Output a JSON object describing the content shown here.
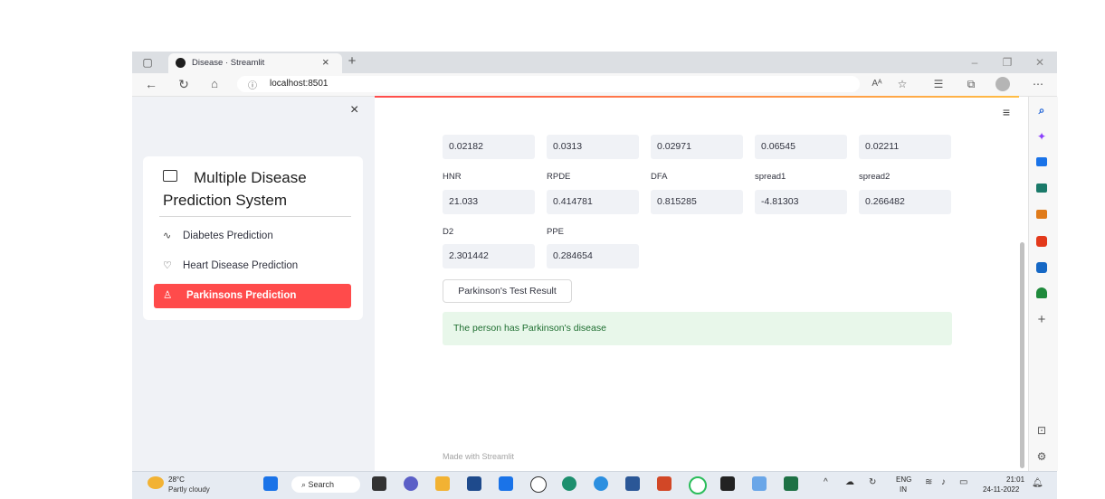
{
  "browser": {
    "tab_title": "Disease · Streamlit",
    "url": "localhost:8501",
    "reader_icon": "Aᴬ"
  },
  "sidebar": {
    "close_label": "×",
    "title": "Multiple Disease Prediction System",
    "items": [
      {
        "label": "Diabetes Prediction",
        "icon": "activity-icon"
      },
      {
        "label": "Heart Disease Prediction",
        "icon": "heart-icon"
      },
      {
        "label": "Parkinsons Prediction",
        "icon": "person-icon",
        "active": true
      }
    ],
    "accent": "#ff4b4b"
  },
  "main": {
    "row1": {
      "values": [
        "0.02182",
        "0.0313",
        "0.02971",
        "0.06545",
        "0.02211"
      ]
    },
    "row2": {
      "labels": [
        "HNR",
        "RPDE",
        "DFA",
        "spread1",
        "spread2"
      ],
      "values": [
        "21.033",
        "0.414781",
        "0.815285",
        "-4.81303",
        "0.266482"
      ]
    },
    "row3": {
      "labels": [
        "D2",
        "PPE"
      ],
      "values": [
        "2.301442",
        "0.284654"
      ]
    },
    "result_button": "Parkinson's Test Result",
    "result_message": "The person has Parkinson's disease",
    "footer": "Made with Streamlit"
  },
  "taskbar": {
    "weather_temp": "28°C",
    "weather_desc": "Partly cloudy",
    "search_label": "Search",
    "lang": "ENG",
    "region": "IN",
    "time": "21:01",
    "date": "24-11-2022"
  }
}
